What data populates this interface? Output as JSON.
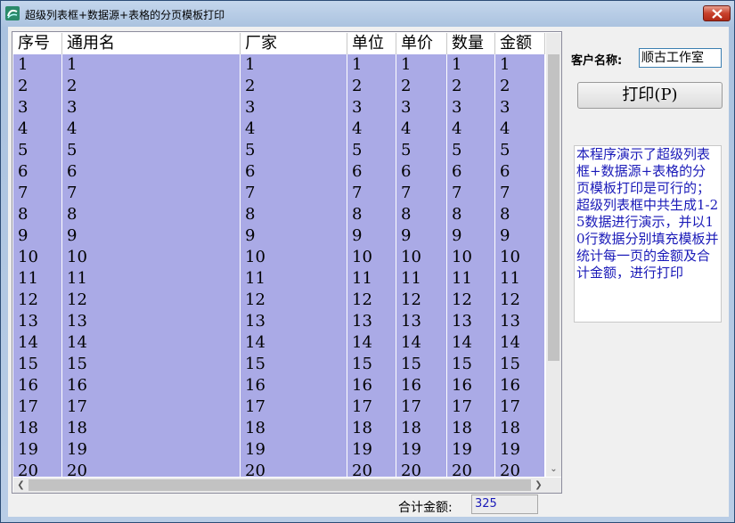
{
  "window": {
    "title": "超级列表框+数据源+表格的分页模板打印"
  },
  "grid": {
    "columns": [
      "序号",
      "通用名",
      "厂家",
      "单位",
      "单价",
      "数量",
      "金额"
    ],
    "rows": [
      [
        "1",
        "1",
        "1",
        "1",
        "1",
        "1",
        "1"
      ],
      [
        "2",
        "2",
        "2",
        "2",
        "2",
        "2",
        "2"
      ],
      [
        "3",
        "3",
        "3",
        "3",
        "3",
        "3",
        "3"
      ],
      [
        "4",
        "4",
        "4",
        "4",
        "4",
        "4",
        "4"
      ],
      [
        "5",
        "5",
        "5",
        "5",
        "5",
        "5",
        "5"
      ],
      [
        "6",
        "6",
        "6",
        "6",
        "6",
        "6",
        "6"
      ],
      [
        "7",
        "7",
        "7",
        "7",
        "7",
        "7",
        "7"
      ],
      [
        "8",
        "8",
        "8",
        "8",
        "8",
        "8",
        "8"
      ],
      [
        "9",
        "9",
        "9",
        "9",
        "9",
        "9",
        "9"
      ],
      [
        "10",
        "10",
        "10",
        "10",
        "10",
        "10",
        "10"
      ],
      [
        "11",
        "11",
        "11",
        "11",
        "11",
        "11",
        "11"
      ],
      [
        "12",
        "12",
        "12",
        "12",
        "12",
        "12",
        "12"
      ],
      [
        "13",
        "13",
        "13",
        "13",
        "13",
        "13",
        "13"
      ],
      [
        "14",
        "14",
        "14",
        "14",
        "14",
        "14",
        "14"
      ],
      [
        "15",
        "15",
        "15",
        "15",
        "15",
        "15",
        "15"
      ],
      [
        "16",
        "16",
        "16",
        "16",
        "16",
        "16",
        "16"
      ],
      [
        "17",
        "17",
        "17",
        "17",
        "17",
        "17",
        "17"
      ],
      [
        "18",
        "18",
        "18",
        "18",
        "18",
        "18",
        "18"
      ],
      [
        "19",
        "19",
        "19",
        "19",
        "19",
        "19",
        "19"
      ],
      [
        "20",
        "20",
        "20",
        "20",
        "20",
        "20",
        "20"
      ]
    ]
  },
  "customer": {
    "label": "客户名称:",
    "value": "顺古工作室"
  },
  "print_button": {
    "label": "打印(P)"
  },
  "description": "本程序演示了超级列表框+数据源+表格的分页模板打印是可行的；超级列表框中共生成1-25数据进行演示，并以10行数据分别填充模板并统计每一页的金额及合计金额，进行打印",
  "total": {
    "label": "合计金额:",
    "value": "325"
  },
  "colors": {
    "row_fill": "#aaaae6",
    "description_text": "#1a1ab8"
  }
}
